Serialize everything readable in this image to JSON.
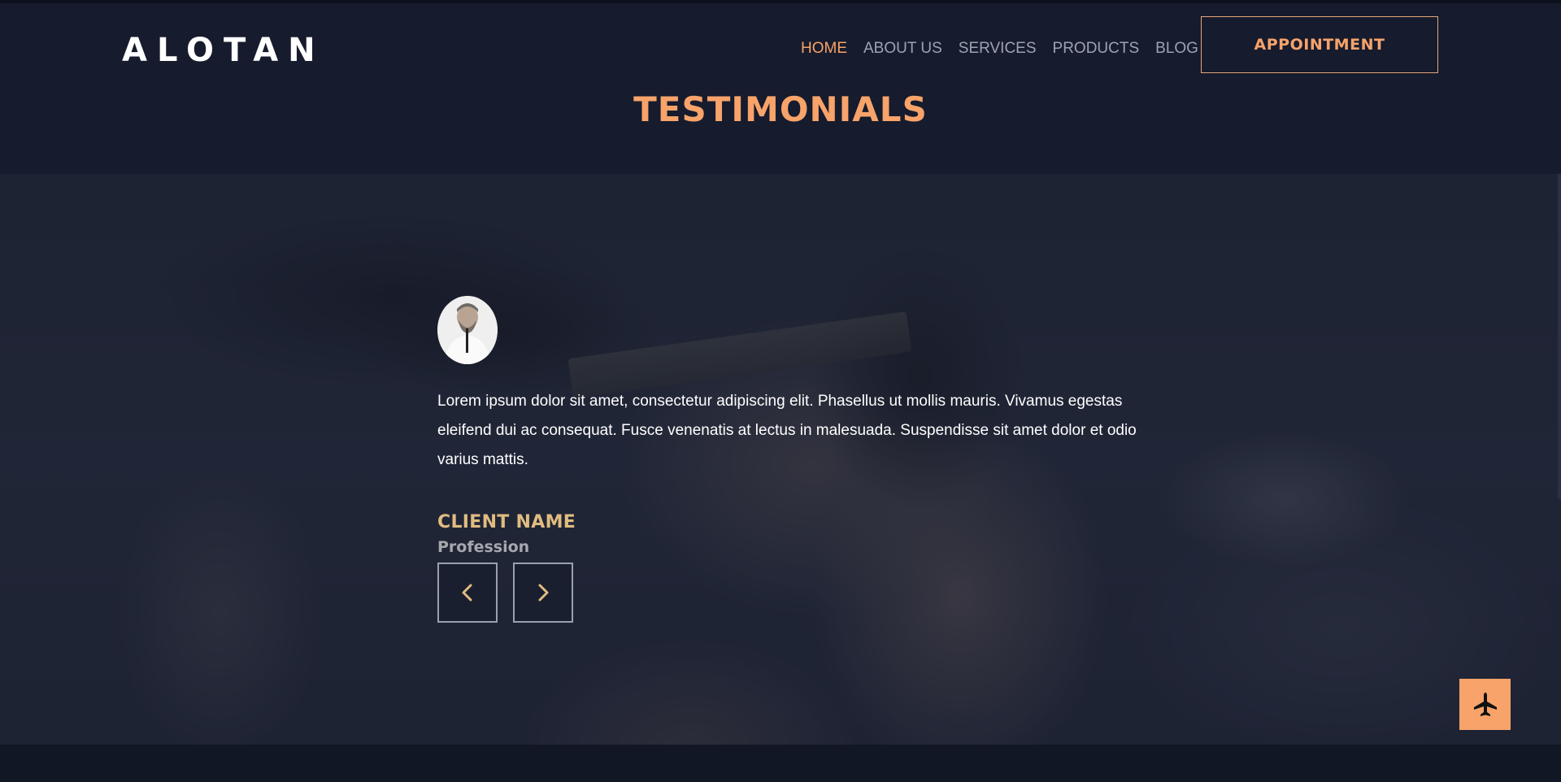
{
  "brand": {
    "logo": "ALOTAN"
  },
  "nav": {
    "items": [
      {
        "label": "HOME",
        "active": true
      },
      {
        "label": "ABOUT US",
        "active": false
      },
      {
        "label": "SERVICES",
        "active": false
      },
      {
        "label": "PRODUCTS",
        "active": false
      },
      {
        "label": "BLOG",
        "active": false
      }
    ],
    "appointment_label": "APPOINTMENT"
  },
  "section": {
    "title": "TESTIMONIALS"
  },
  "testimonial": {
    "quote": "Lorem ipsum dolor sit amet, consectetur adipiscing elit. Phasellus ut mollis mauris. Vivamus egestas eleifend dui ac consequat. Fusce venenatis at lectus in malesuada. Suspendisse sit amet dolor et odio varius mattis.",
    "client_name": "CLIENT NAME",
    "profession": "Profession"
  },
  "controls": {
    "prev_icon": "chevron-left-icon",
    "next_icon": "chevron-right-icon",
    "fab_icon": "airplane-icon"
  },
  "colors": {
    "background": "#161b2d",
    "accent": "#f7a36a",
    "client_name": "#e1bc80"
  }
}
